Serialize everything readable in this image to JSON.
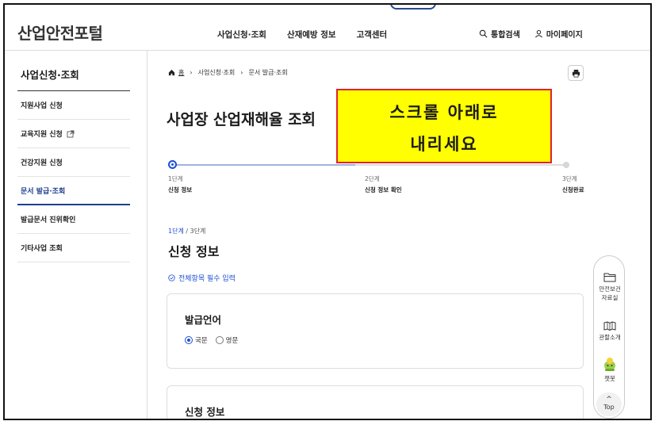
{
  "header": {
    "logo": "산업안전포털",
    "nav": [
      "사업신청·조회",
      "산재예방 정보",
      "고객센터"
    ],
    "search_label": "통합검색",
    "mypage_label": "마이페이지"
  },
  "sidebar": {
    "title": "사업신청·조회",
    "items": [
      {
        "label": "지원사업 신청",
        "active": false,
        "external": false
      },
      {
        "label": "교육지원 신청",
        "active": false,
        "external": true
      },
      {
        "label": "건강지원 신청",
        "active": false,
        "external": false
      },
      {
        "label": "문서 발급·조회",
        "active": true,
        "external": false
      },
      {
        "label": "발급문서 진위확인",
        "active": false,
        "external": false
      },
      {
        "label": "기타사업 조회",
        "active": false,
        "external": false
      }
    ]
  },
  "breadcrumb": [
    "홈",
    "사업신청·조회",
    "문서 발급·조회"
  ],
  "page_title": "사업장 산업재해율 조회",
  "overlay": {
    "line1": "스크롤 아래로",
    "line2": "내리세요"
  },
  "stepper": {
    "steps": [
      {
        "num": "1단계",
        "label": "신청 정보"
      },
      {
        "num": "2단계",
        "label": "신청 정보 확인"
      },
      {
        "num": "3단계",
        "label": "신청완료"
      }
    ],
    "current": 1
  },
  "step_indicator": {
    "current": "1단계",
    "total": "/ 3단계"
  },
  "section_title": "신청 정보",
  "required_note": "전체항목 필수 입력",
  "language_card": {
    "title": "발급언어",
    "options": [
      "국문",
      "영문"
    ],
    "selected": "국문"
  },
  "info_card_title": "신청 정보",
  "quick_menu": {
    "items": [
      "안전보건\n자료실",
      "관할소개",
      "챗봇"
    ],
    "top_label": "Top"
  },
  "colors": {
    "accent": "#1d4fd6",
    "overlay_bg": "#ffff00",
    "overlay_border": "#e0232f"
  }
}
